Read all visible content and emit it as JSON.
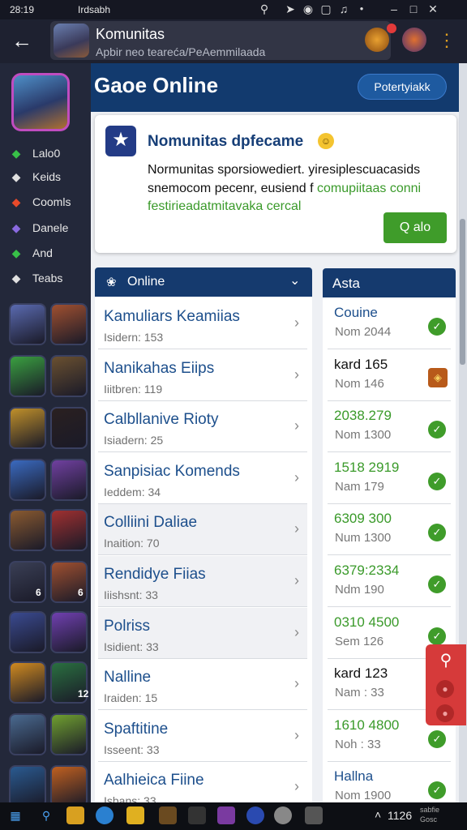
{
  "status_bar": {
    "time": "28:19",
    "app": "Irdsabh"
  },
  "app_bar": {
    "title": "Komunitas",
    "subtitle": "Apbir neo teareća/PeAemmilaada"
  },
  "banner": {
    "title": "Gaoe Online",
    "button_label": "Potertyiakk"
  },
  "sidebar": {
    "items": [
      {
        "label": "Lalo0",
        "icon": "gamepad-icon",
        "color": "#38c048"
      },
      {
        "label": "Keids",
        "icon": "swords-icon",
        "color": "#e0e0e0"
      },
      {
        "label": "Coomls",
        "icon": "fire-icon",
        "color": "#e84a2a"
      },
      {
        "label": "Danele",
        "icon": "globe-icon",
        "color": "#8a6ae0"
      },
      {
        "label": "And",
        "icon": "people-icon",
        "color": "#38c048"
      },
      {
        "label": "Teabs",
        "icon": "chat-icon",
        "color": "#e0e0e0"
      }
    ],
    "tile_badges": [
      "6",
      "6",
      "12"
    ]
  },
  "card": {
    "title": "Nomunitas dpfecame",
    "line1": "Normunitas sporsiowediert. yiresiplescuacasids",
    "line2_prefix": "snemocom pecenr, eusiend f",
    "line2_green": "comupiitaas conni",
    "line3": "festirieadatmitavaka cercal",
    "button_label": "Q alo"
  },
  "online": {
    "header": "Online",
    "rows": [
      {
        "name": "Kamuliars Keamiias",
        "detail": "Isidern: 153"
      },
      {
        "name": "Nanikahas Eiips",
        "detail": "Iiitbren: 119"
      },
      {
        "name": "Calbllanive Rioty",
        "detail": "Isiadern: 25"
      },
      {
        "name": "Sanpisiac Komends",
        "detail": "Ieddem: 34"
      },
      {
        "name": "Colliini Daliae",
        "detail": "Inaition: 70"
      },
      {
        "name": "Rendidye Fiias",
        "detail": "Iiishsnt: 33"
      },
      {
        "name": "Polriss",
        "detail": "Isidient: 33"
      },
      {
        "name": "Nalline",
        "detail": "Iraiden: 15"
      },
      {
        "name": "Spaftitine",
        "detail": "Isseent: 33"
      },
      {
        "name": "Aalhieica Fiine",
        "detail": "Isbans: 33"
      }
    ]
  },
  "asta": {
    "header": "Asta",
    "rows": [
      {
        "value": "Couine",
        "detail": "Nom 2044",
        "value_color": "#1d4f8c",
        "badge": "check"
      },
      {
        "value": "kard 165",
        "detail": "Nom 146",
        "value_color": "#111111",
        "badge": "shield"
      },
      {
        "value": "2038.279",
        "detail": "Nom 1300",
        "value_color": "#3a9a2a",
        "badge": "check"
      },
      {
        "value": "1518 2919",
        "detail": "Nam 179",
        "value_color": "#3a9a2a",
        "badge": "check"
      },
      {
        "value": "6309 300",
        "detail": "Num 1300",
        "value_color": "#3a9a2a",
        "badge": "check"
      },
      {
        "value": "6379:2334",
        "detail": "Ndm 190",
        "value_color": "#3a9a2a",
        "badge": "check"
      },
      {
        "value": "0310 4500",
        "detail": "Sem 126",
        "value_color": "#3a9a2a",
        "badge": "check"
      },
      {
        "value": "kard 123",
        "detail": "Nam : 33",
        "value_color": "#111111",
        "badge": "none"
      },
      {
        "value": "1610 4800",
        "detail": "Noh : 33",
        "value_color": "#3a9a2a",
        "badge": "check"
      },
      {
        "value": "Hallna",
        "detail": "Nom 1900",
        "value_color": "#1d4f8c",
        "badge": "check"
      }
    ]
  },
  "taskbar": {
    "time": "1126",
    "tray_line1": "sabfie",
    "tray_line2": "Gosc"
  },
  "colors": {
    "accent": "#153a6e",
    "green": "#3f9c2a",
    "link": "#1d4f8c",
    "alert": "#d63a3a"
  }
}
